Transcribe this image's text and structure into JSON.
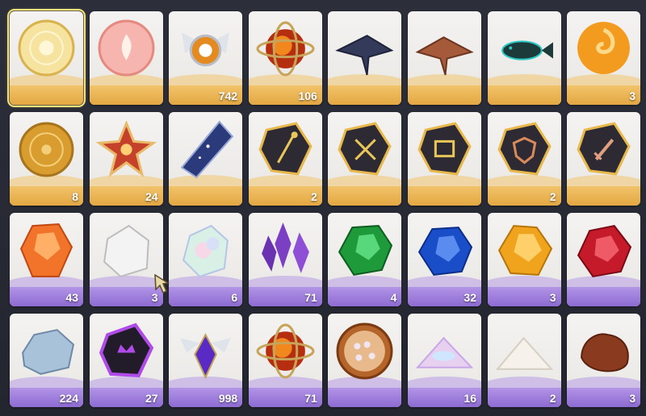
{
  "colors": {
    "gold_band": "#e3a742",
    "purple_band": "#8d6bd2",
    "selected_outline": "#f3e27a"
  },
  "items": [
    {
      "icon": "sun-sigil-orb-icon",
      "count": "",
      "band": "gold",
      "selected": true
    },
    {
      "icon": "flame-sigil-orb-icon",
      "count": "",
      "band": "gold"
    },
    {
      "icon": "winged-amber-emblem-icon",
      "count": "742",
      "band": "gold"
    },
    {
      "icon": "fire-core-orb-icon",
      "count": "106",
      "band": "gold"
    },
    {
      "icon": "dark-manta-ray-icon",
      "count": "",
      "band": "gold"
    },
    {
      "icon": "brown-stingray-icon",
      "count": "",
      "band": "gold"
    },
    {
      "icon": "teal-spotted-fish-icon",
      "count": "",
      "band": "gold"
    },
    {
      "icon": "amber-swirl-orb-icon",
      "count": "3",
      "band": "gold"
    },
    {
      "icon": "golden-sun-seal-icon",
      "count": "8",
      "band": "gold"
    },
    {
      "icon": "radiant-star-shard-icon",
      "count": "24",
      "band": "gold"
    },
    {
      "icon": "starry-crystal-shard-icon",
      "count": "",
      "band": "gold"
    },
    {
      "icon": "staff-rune-stone-icon",
      "count": "2",
      "band": "gold"
    },
    {
      "icon": "crossed-swords-rune-stone-icon",
      "count": "",
      "band": "gold"
    },
    {
      "icon": "book-rune-stone-icon",
      "count": "",
      "band": "gold"
    },
    {
      "icon": "shield-rune-stone-icon",
      "count": "2",
      "band": "gold"
    },
    {
      "icon": "sword-rune-stone-icon",
      "count": "",
      "band": "gold"
    },
    {
      "icon": "orange-gem-ore-icon",
      "count": "43",
      "band": "purple"
    },
    {
      "icon": "white-stone-icon",
      "count": "3",
      "band": "purple"
    },
    {
      "icon": "opal-stone-icon",
      "count": "6",
      "band": "purple"
    },
    {
      "icon": "amethyst-cluster-icon",
      "count": "71",
      "band": "purple"
    },
    {
      "icon": "emerald-ore-icon",
      "count": "4",
      "band": "purple"
    },
    {
      "icon": "sapphire-ore-icon",
      "count": "32",
      "band": "purple"
    },
    {
      "icon": "topaz-ore-icon",
      "count": "3",
      "band": "purple"
    },
    {
      "icon": "ruby-ore-icon",
      "count": "",
      "band": "purple"
    },
    {
      "icon": "frost-ore-icon",
      "count": "224",
      "band": "purple"
    },
    {
      "icon": "crown-rune-stone-icon",
      "count": "27",
      "band": "purple"
    },
    {
      "icon": "winged-violet-gem-icon",
      "count": "998",
      "band": "purple"
    },
    {
      "icon": "fire-core-orb-icon",
      "count": "71",
      "band": "purple"
    },
    {
      "icon": "pearl-tray-icon",
      "count": "",
      "band": "purple"
    },
    {
      "icon": "iridescent-powder-icon",
      "count": "16",
      "band": "purple"
    },
    {
      "icon": "white-powder-icon",
      "count": "2",
      "band": "purple"
    },
    {
      "icon": "brown-clump-icon",
      "count": "3",
      "band": "purple"
    }
  ]
}
